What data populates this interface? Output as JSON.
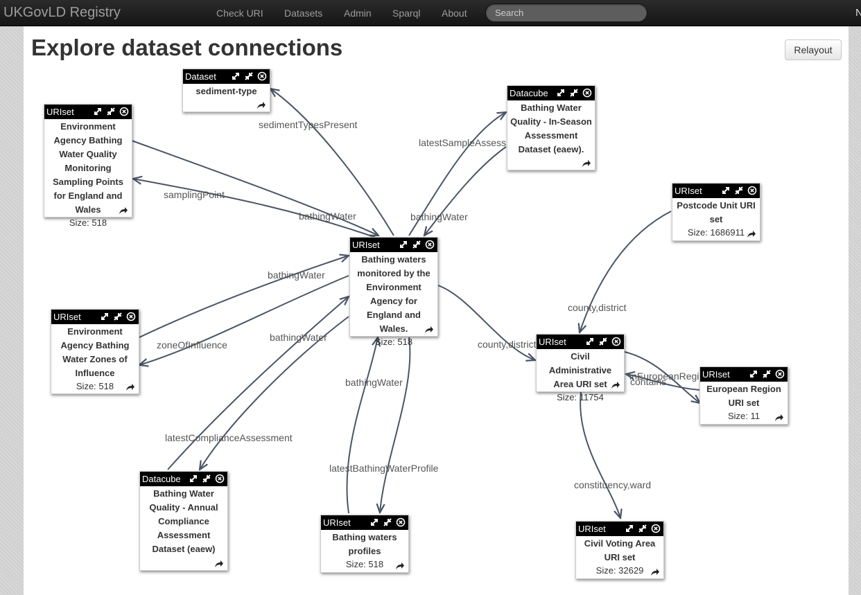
{
  "navbar": {
    "brand": "UKGovLD Registry",
    "links": [
      {
        "label": "Check URI"
      },
      {
        "label": "Datasets"
      },
      {
        "label": "Admin"
      },
      {
        "label": "Sparql"
      },
      {
        "label": "About"
      }
    ],
    "search_placeholder": "Search",
    "overflow_text": "N"
  },
  "page": {
    "title": "Explore dataset connections",
    "relayout_label": "Relayout"
  },
  "graph": {
    "edge_color": "#4a5565",
    "nodes": [
      {
        "id": "sediment",
        "type": "Dataset",
        "title": "sediment-type",
        "size": ""
      },
      {
        "id": "sampling",
        "type": "URIset",
        "title": "Environment Agency Bathing Water Quality Monitoring Sampling Points for England and Wales",
        "size": "Size: 518"
      },
      {
        "id": "inseason",
        "type": "Datacube",
        "title": "Bathing Water Quality - In-Season Assessment Dataset (eaew).",
        "size": ""
      },
      {
        "id": "postcode",
        "type": "URIset",
        "title": "Postcode Unit URI set",
        "size": "Size: 1686911"
      },
      {
        "id": "bathing",
        "type": "URIset",
        "title": "Bathing waters monitored by the Environment Agency for England and Wales.",
        "size": "Size: 518"
      },
      {
        "id": "zones",
        "type": "URIset",
        "title": "Environment Agency Bathing Water Zones of Influence",
        "size": "Size: 518"
      },
      {
        "id": "civil",
        "type": "URIset",
        "title": "Civil Administrative Area URI set",
        "size": "Size: 11754"
      },
      {
        "id": "european",
        "type": "URIset",
        "title": "European Region URI set",
        "size": "Size: 11"
      },
      {
        "id": "annual",
        "type": "Datacube",
        "title": "Bathing Water Quality - Annual Compliance Assessment Dataset (eaew)",
        "size": ""
      },
      {
        "id": "profiles",
        "type": "URIset",
        "title": "Bathing waters profiles",
        "size": "Size: 518"
      },
      {
        "id": "voting",
        "type": "URIset",
        "title": "Civil Voting Area URI set",
        "size": "Size: 32629"
      }
    ],
    "edge_labels": [
      "sedimentTypesPresent",
      "latestSampleAssessment",
      "samplingPoint",
      "bathingWater",
      "bathingWater",
      "bathingWater",
      "bathingWater",
      "zoneOfInfluence",
      "bathingWater",
      "latestComplianceAssessment",
      "latestBathingWaterProfile",
      "county,district",
      "county,district",
      "inEuropeanRegion",
      "contains",
      "constituency,ward"
    ]
  }
}
